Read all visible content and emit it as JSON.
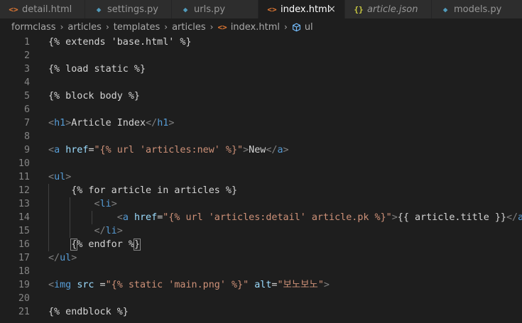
{
  "tabs": [
    {
      "label": "detail.html",
      "icon": "html-icon",
      "icon_glyph": "<>",
      "icon_color": "#e37933",
      "active": false,
      "italic": false,
      "close": false,
      "width": 120
    },
    {
      "label": "settings.py",
      "icon": "python-icon",
      "icon_glyph": "◆",
      "icon_color": "#519aba",
      "active": false,
      "italic": false,
      "close": false,
      "width": 122
    },
    {
      "label": "urls.py",
      "icon": "python-icon",
      "icon_glyph": "◆",
      "icon_color": "#519aba",
      "active": false,
      "italic": false,
      "close": false,
      "width": 122
    },
    {
      "label": "index.html",
      "icon": "html-icon",
      "icon_glyph": "<>",
      "icon_color": "#e37933",
      "active": true,
      "italic": false,
      "close": true,
      "width": 122
    },
    {
      "label": "article.json",
      "icon": "json-icon",
      "icon_glyph": "{}",
      "icon_color": "#cbcb41",
      "active": false,
      "italic": true,
      "close": false,
      "width": 122
    },
    {
      "label": "models.py",
      "icon": "python-icon",
      "icon_glyph": "◆",
      "icon_color": "#519aba",
      "active": false,
      "italic": false,
      "close": false,
      "width": 130
    }
  ],
  "close_glyph": "×",
  "breadcrumb": {
    "items": [
      "formclass",
      "articles",
      "templates",
      "articles"
    ],
    "file": "index.html",
    "file_icon_glyph": "<>",
    "symbol": "ul",
    "separator": "›"
  },
  "code_lines": [
    [
      [
        "jinja",
        "{% extends 'base.html' %}"
      ]
    ],
    [],
    [
      [
        "jinja",
        "{% load static %}"
      ]
    ],
    [],
    [
      [
        "jinja",
        "{% block body %}"
      ]
    ],
    [],
    [
      [
        "punct",
        "<"
      ],
      [
        "tag",
        "h1"
      ],
      [
        "punct",
        ">"
      ],
      [
        "text",
        "Article Index"
      ],
      [
        "punct",
        "</"
      ],
      [
        "tag",
        "h1"
      ],
      [
        "punct",
        ">"
      ]
    ],
    [],
    [
      [
        "punct",
        "<"
      ],
      [
        "tag",
        "a"
      ],
      [
        "text",
        " "
      ],
      [
        "attr",
        "href"
      ],
      [
        "text",
        "="
      ],
      [
        "str",
        "\"{% url 'articles:new' %}\""
      ],
      [
        "punct",
        ">"
      ],
      [
        "text",
        "New"
      ],
      [
        "punct",
        "</"
      ],
      [
        "tag",
        "a"
      ],
      [
        "punct",
        ">"
      ]
    ],
    [],
    [
      [
        "punct",
        "<"
      ],
      [
        "tag",
        "ul"
      ],
      [
        "punct",
        ">"
      ]
    ],
    [
      [
        "text",
        "    "
      ],
      [
        "jinja",
        "{% for article in articles %}"
      ]
    ],
    [
      [
        "text",
        "        "
      ],
      [
        "punct",
        "<"
      ],
      [
        "tag",
        "li"
      ],
      [
        "punct",
        ">"
      ]
    ],
    [
      [
        "text",
        "            "
      ],
      [
        "punct",
        "<"
      ],
      [
        "tag",
        "a"
      ],
      [
        "text",
        " "
      ],
      [
        "attr",
        "href"
      ],
      [
        "text",
        "="
      ],
      [
        "str",
        "\"{% url 'articles:detail' article.pk %}\""
      ],
      [
        "punct",
        ">"
      ],
      [
        "text",
        "{{ article.title }}"
      ],
      [
        "punct",
        "</"
      ],
      [
        "tag",
        "a"
      ],
      [
        "punct",
        ">"
      ]
    ],
    [
      [
        "text",
        "        "
      ],
      [
        "punct",
        "</"
      ],
      [
        "tag",
        "li"
      ],
      [
        "punct",
        ">"
      ]
    ],
    [
      [
        "text",
        "    "
      ],
      [
        "jinja",
        "{% endfor %}"
      ]
    ],
    [
      [
        "punct",
        "</"
      ],
      [
        "tag",
        "ul"
      ],
      [
        "punct",
        ">"
      ]
    ],
    [],
    [
      [
        "punct",
        "<"
      ],
      [
        "tag",
        "img"
      ],
      [
        "text",
        " "
      ],
      [
        "attr",
        "src"
      ],
      [
        "text",
        " ="
      ],
      [
        "str",
        "\"{% static 'main.png' %}\""
      ],
      [
        "text",
        " "
      ],
      [
        "attr",
        "alt"
      ],
      [
        "text",
        "="
      ],
      [
        "str",
        "\"보노보노\""
      ],
      [
        "punct",
        ">"
      ]
    ],
    [],
    [
      [
        "jinja",
        "{% endblock %}"
      ]
    ]
  ],
  "colors": {
    "background": "#1e1e1e",
    "tab_inactive": "#2d2d2d",
    "tab_active": "#1e1e1e",
    "line_number": "#858585"
  }
}
